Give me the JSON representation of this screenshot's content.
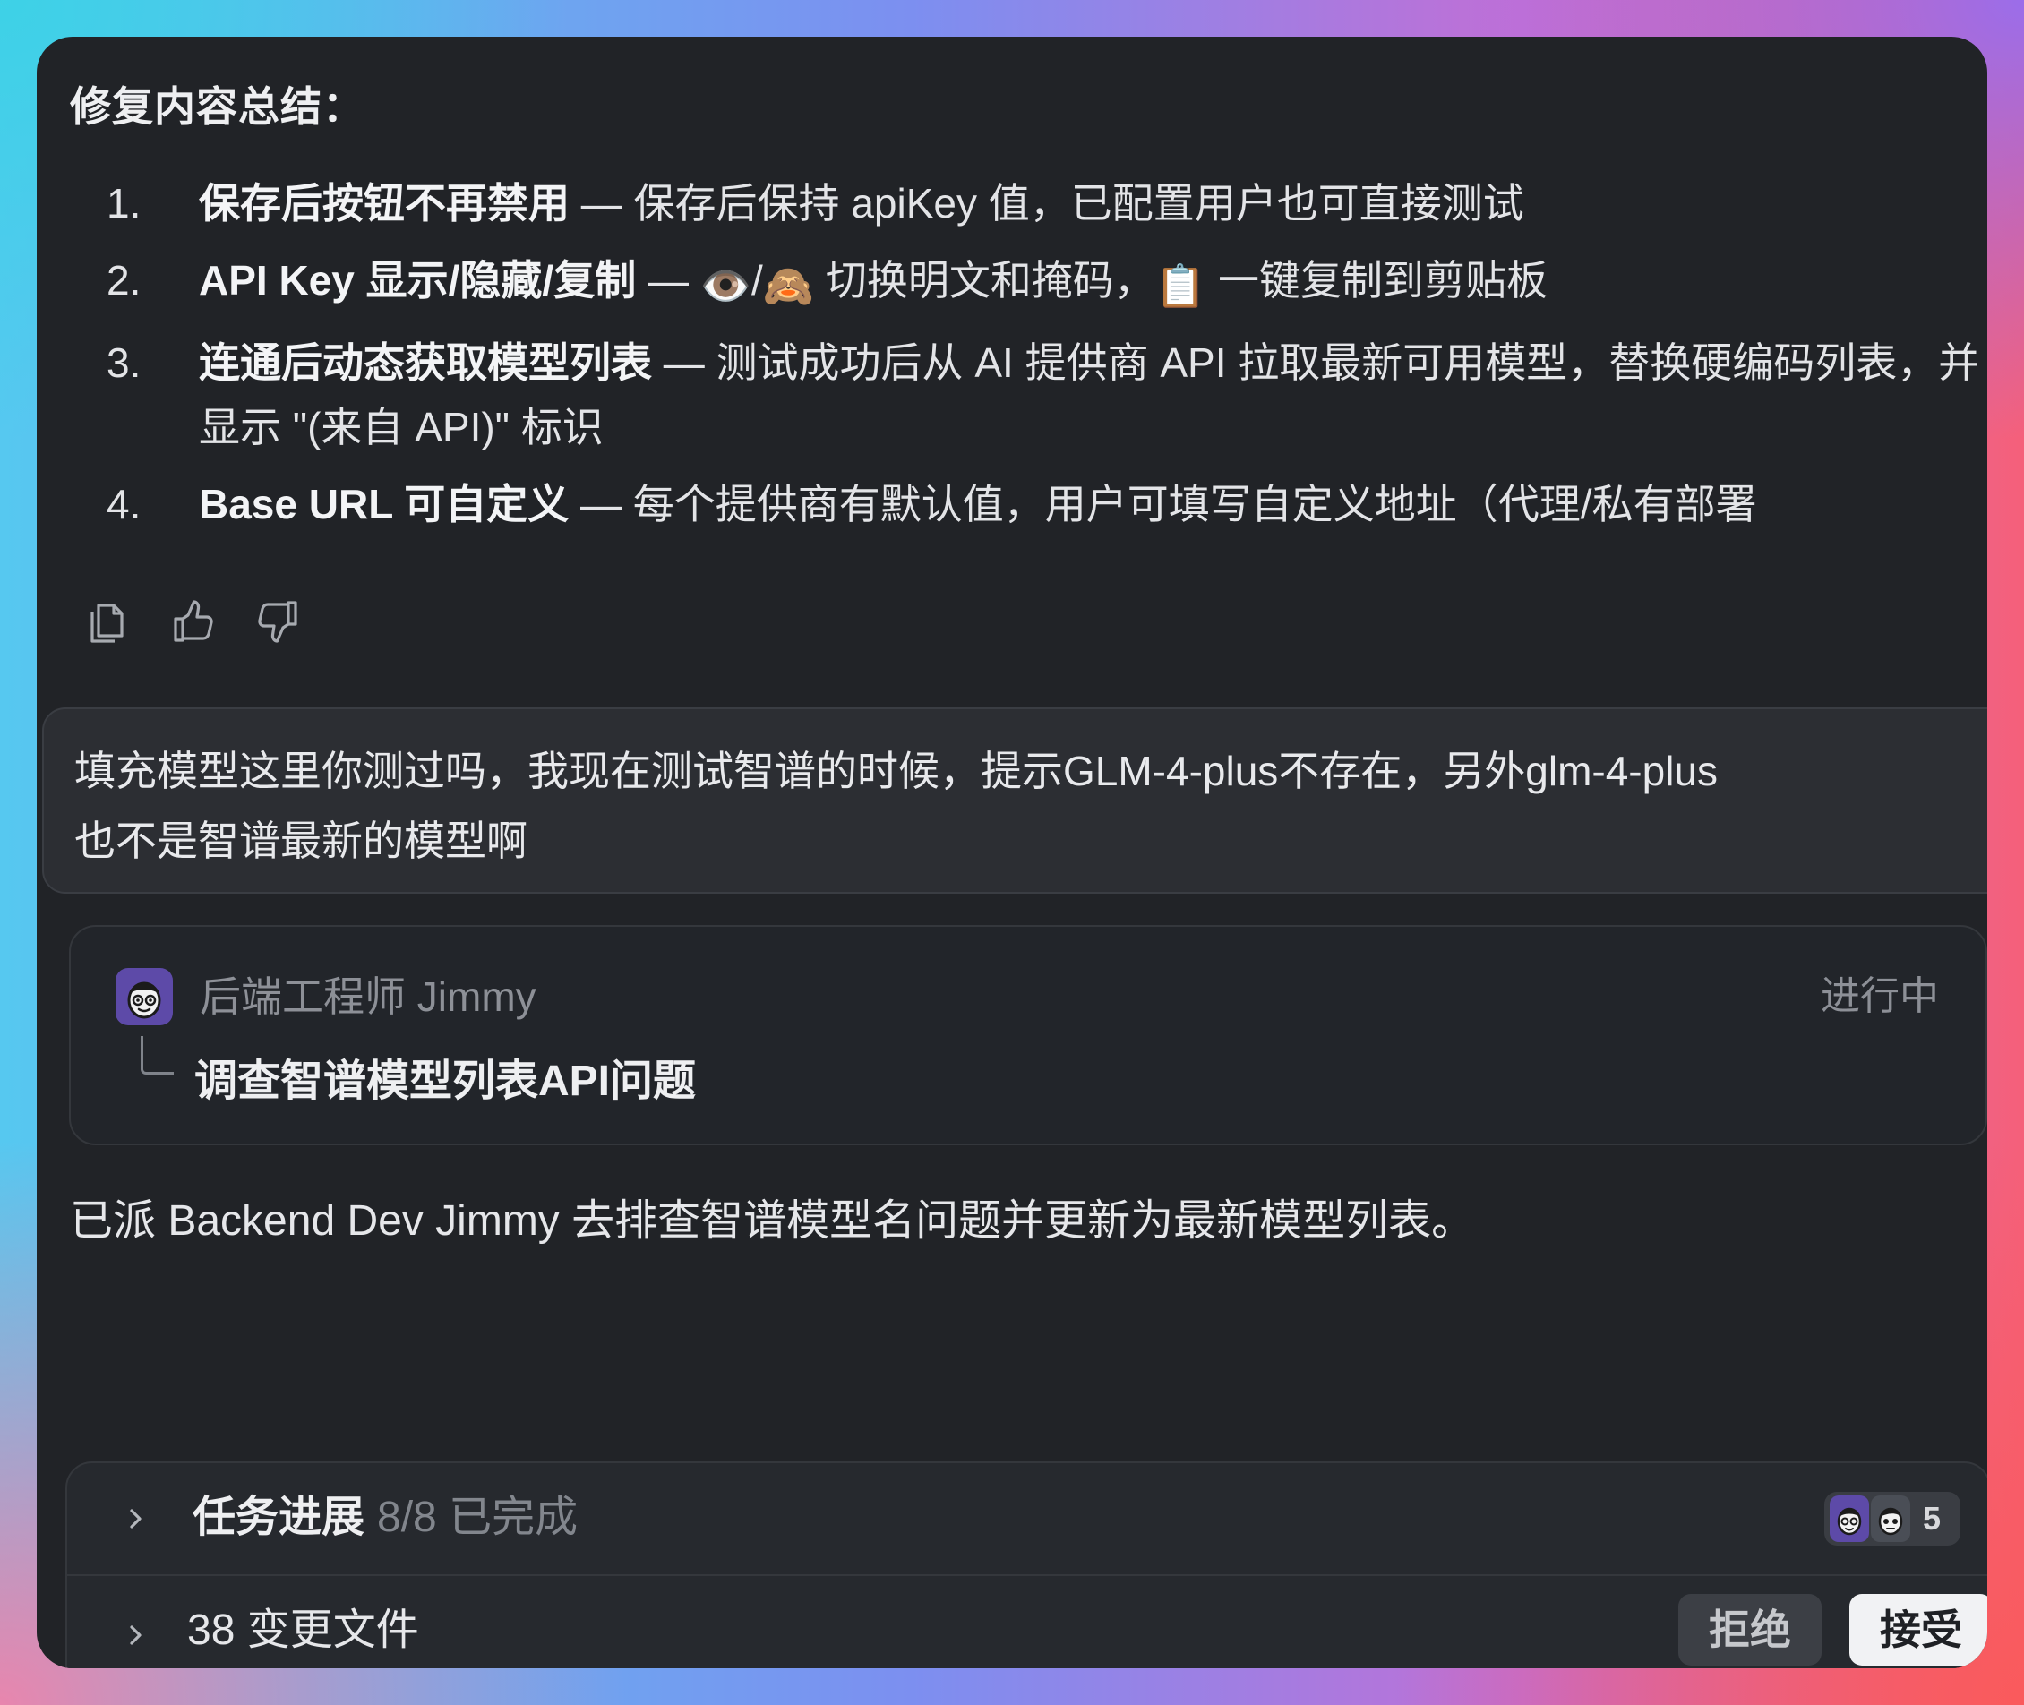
{
  "summary": {
    "title": "修复内容总结："
  },
  "fix_items": [
    {
      "num": "1.",
      "title": "保存后按钮不再禁用",
      "rest": " — 保存后保持 apiKey 值，已配置用户也可直接测试"
    },
    {
      "num": "2.",
      "title": "API Key 显示/隐藏/复制",
      "rest_a": " — ",
      "emoji_eye": "👁️",
      "slash": "/",
      "emoji_monkey": "🙈",
      "rest_b": " 切换明文和掩码，",
      "emoji_clipboard": "📋",
      "rest_c": " 一键复制到剪贴板"
    },
    {
      "num": "3.",
      "title": "连通后动态获取模型列表",
      "rest": " — 测试成功后从 AI 提供商 API 拉取最新可用模型，替换硬编码列表，并显示 \"(来自 API)\" 标识"
    },
    {
      "num": "4.",
      "title": "Base URL 可自定义",
      "rest": " — 每个提供商有默认值，用户可填写自定义地址（代理/私有部署"
    }
  ],
  "feedback": {
    "copy_icon": "copy-icon",
    "thumbs_up_icon": "thumbs-up-icon",
    "thumbs_down_icon": "thumbs-down-icon"
  },
  "user_message": {
    "text": "填充模型这里你测过吗，我现在测试智谱的时候，提示GLM-4-plus不存在，另外glm-4-plus\n也不是智谱最新的模型啊"
  },
  "task_card": {
    "agent_name": "后端工程师 Jimmy",
    "status": "进行中",
    "task_title": "调查智谱模型列表API问题"
  },
  "assistant_message": {
    "text": "已派 Backend Dev Jimmy 去排查智谱模型名问题并更新为最新模型列表。"
  },
  "bottom_panel": {
    "progress_label": "任务进展",
    "progress_count": "8/8 已完成",
    "avatar_count": "5",
    "files_label": "38 变更文件",
    "reject_label": "拒绝",
    "accept_label": "接受"
  },
  "colors": {
    "window_bg": "#212327",
    "bubble_bg": "#2c2e33",
    "accent_avatar": "#5d4aa8",
    "accept_bg": "#f1f2f4",
    "reject_bg": "#3c3f45"
  }
}
